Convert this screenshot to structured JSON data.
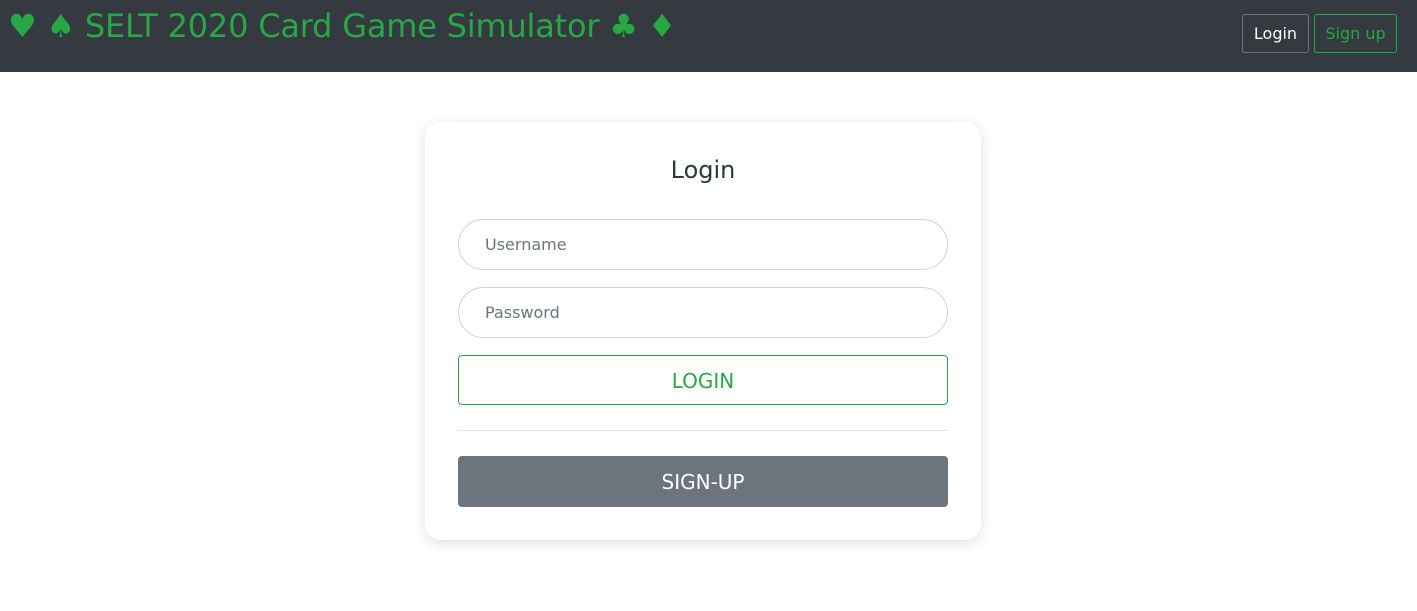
{
  "header": {
    "brand": "♥ ♠ SELT 2020 Card Game Simulator ♣ ♦",
    "login_label": "Login",
    "signup_label": "Sign up"
  },
  "login_card": {
    "title": "Login",
    "username_placeholder": "Username",
    "password_placeholder": "Password",
    "login_button": "LOGIN",
    "signup_button": "SIGN-UP"
  },
  "colors": {
    "navbar": "#343a40",
    "accent_green": "#28a745",
    "secondary_gray": "#6c757d"
  }
}
